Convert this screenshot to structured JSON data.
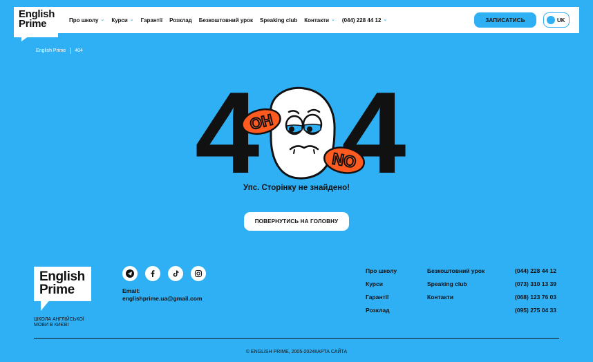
{
  "header": {
    "logo_line1": "English",
    "logo_line2": "Prime",
    "nav": [
      {
        "label": "Про школу",
        "dropdown": true
      },
      {
        "label": "Курси",
        "dropdown": true
      },
      {
        "label": "Гарантії",
        "dropdown": false
      },
      {
        "label": "Розклад",
        "dropdown": false
      },
      {
        "label": "Безкоштовний урок",
        "dropdown": false
      },
      {
        "label": "Speaking club",
        "dropdown": false
      },
      {
        "label": "Контакти",
        "dropdown": true
      },
      {
        "label": "(044) 228 44 12",
        "dropdown": true
      }
    ],
    "signup_label": "ЗАПИСАТИСЬ",
    "lang_label": "UK"
  },
  "breadcrumb": {
    "home": "English Prime",
    "current": "404"
  },
  "error": {
    "code_left": "4",
    "code_right": "4",
    "sticker_oh": "OH",
    "sticker_no": "NO",
    "message": "Упс. Сторінку не знайдено!",
    "home_button": "ПОВЕРНУТИСЬ НА ГОЛОВНУ"
  },
  "footer": {
    "logo_line1": "English",
    "logo_line2": "Prime",
    "tagline_line1": "ШКОЛА АНГЛІЙСЬКОЇ",
    "tagline_line2": "МОВИ В КИЄВІ",
    "socials": [
      "telegram-icon",
      "facebook-icon",
      "tiktok-icon",
      "instagram-icon"
    ],
    "email_label": "Email:",
    "email": "englishprime.ua@gmail.com",
    "col1": [
      "Про школу",
      "Курси",
      "Гарантії",
      "Розклад"
    ],
    "col2": [
      "Безкоштовний урок",
      "Speaking club",
      "Контакти"
    ],
    "phones": [
      "(044) 228 44 12",
      "(073) 310 13 39",
      "(068) 123 76 03",
      "(095) 275 04 33"
    ],
    "copyright": "© ENGLISH PRIME, 2005-2024КАРТА САЙТА"
  },
  "colors": {
    "background": "#2fb0f5",
    "accent_orange": "#ff5a1f",
    "text": "#111111"
  }
}
